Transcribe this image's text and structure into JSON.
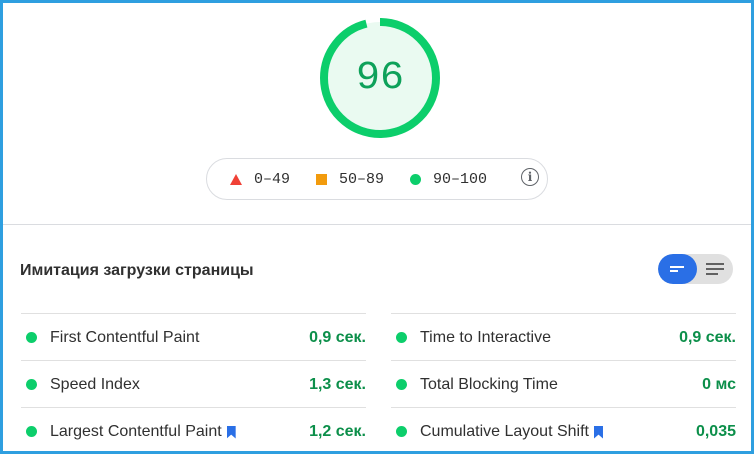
{
  "score": {
    "value": "96",
    "fraction": 0.96,
    "color": "#0cce6b",
    "fill_color": "#eafaf1",
    "text_color": "#0ea15a"
  },
  "legend": {
    "items": [
      {
        "icon": "triangle-icon",
        "label": "0–49",
        "color": "#f04136"
      },
      {
        "icon": "square-icon",
        "label": "50–89",
        "color": "#f29b0d"
      },
      {
        "icon": "circle-icon",
        "label": "90–100",
        "color": "#0cce6b"
      }
    ],
    "info_icon": "info-icon"
  },
  "section": {
    "title": "Имитация загрузки страницы"
  },
  "toggle": {
    "left_icon": "compact-view-icon",
    "right_icon": "expanded-view-icon",
    "active": "left",
    "active_color": "#2a6fe6"
  },
  "metrics": {
    "left": [
      {
        "label": "First Contentful Paint",
        "value": "0,9 сек.",
        "bookmark": false
      },
      {
        "label": "Speed Index",
        "value": "1,3 сек.",
        "bookmark": false
      },
      {
        "label": "Largest Contentful Paint",
        "value": "1,2 сек.",
        "bookmark": true
      }
    ],
    "right": [
      {
        "label": "Time to Interactive",
        "value": "0,9 сек.",
        "bookmark": false
      },
      {
        "label": "Total Blocking Time",
        "value": "0 мс",
        "bookmark": false
      },
      {
        "label": "Cumulative Layout Shift",
        "value": "0,035",
        "bookmark": true
      }
    ],
    "status_color": "#0cce6b",
    "value_color": "#0c8f4a",
    "bookmark_color": "#2a6fe6"
  }
}
